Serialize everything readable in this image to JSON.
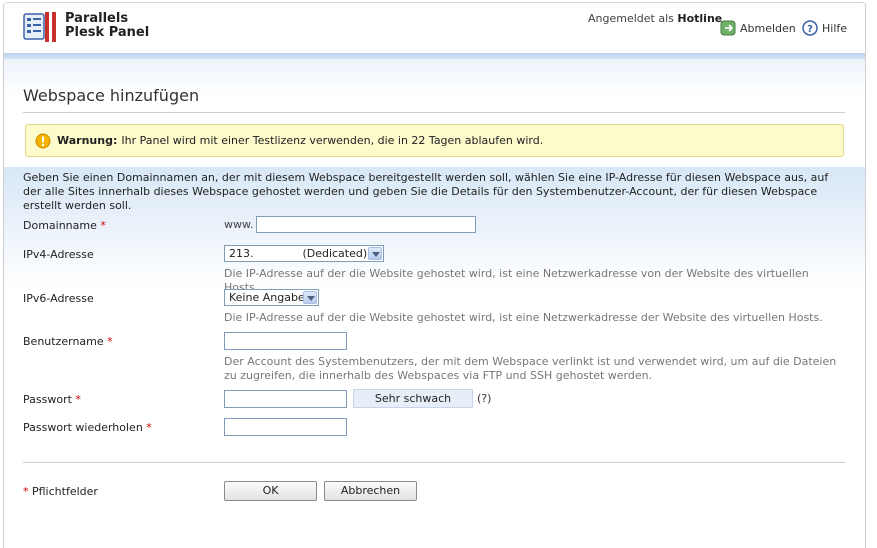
{
  "header": {
    "brand_line1": "Parallels",
    "brand_line2": "Plesk Panel",
    "logged_in_prefix": "Angemeldet als",
    "username": "Hotline",
    "logout_label": "Abmelden",
    "help_label": "Hilfe"
  },
  "page": {
    "title": "Webspace hinzufügen"
  },
  "warning": {
    "label": "Warnung:",
    "text": "Ihr Panel wird mit einer Testlizenz verwenden, die in 22 Tagen ablaufen wird."
  },
  "intro": "Geben Sie einen Domainnamen an, der mit diesem Webspace bereitgestellt werden soll, wählen Sie eine IP-Adresse für diesen Webspace aus, auf der alle Sites innerhalb dieses Webspace gehostet werden und geben Sie die Details für den Systembenutzer-Account, der für diesen Webspace erstellt werden soll.",
  "form": {
    "domain_label": "Domainname",
    "domain_prefix": "www.",
    "domain_value": "",
    "ipv4_label": "IPv4-Adresse",
    "ipv4_value": "213.              (Dedicated)",
    "ipv4_hint": "Die IP-Adresse auf der die Website gehostet wird, ist eine Netzwerkadresse von der Website des virtuellen Hosts.",
    "ipv6_label": "IPv6-Adresse",
    "ipv6_value": "Keine Angabe",
    "ipv6_hint": "Die IP-Adresse auf der die Website gehostet wird, ist eine Netzwerkadresse der Website des virtuellen Hosts.",
    "username_label": "Benutzername",
    "username_value": "",
    "username_hint": "Der Account des Systembenutzers, der mit dem Webspace verlinkt ist und verwendet wird, um auf die Dateien zu zugreifen, die innerhalb des Webspaces via FTP und SSH gehostet werden.",
    "password_label": "Passwort",
    "password_strength": "Sehr schwach",
    "password_help": "(?)",
    "password_repeat_label": "Passwort wiederholen",
    "required_mark": "*"
  },
  "footer": {
    "required_note": "Pflichtfelder",
    "ok_label": "OK",
    "cancel_label": "Abbrechen"
  },
  "colors": {
    "required": "#cc0000",
    "warning_bg": "#fdfacc",
    "accent_blue": "#b9d2ee"
  }
}
